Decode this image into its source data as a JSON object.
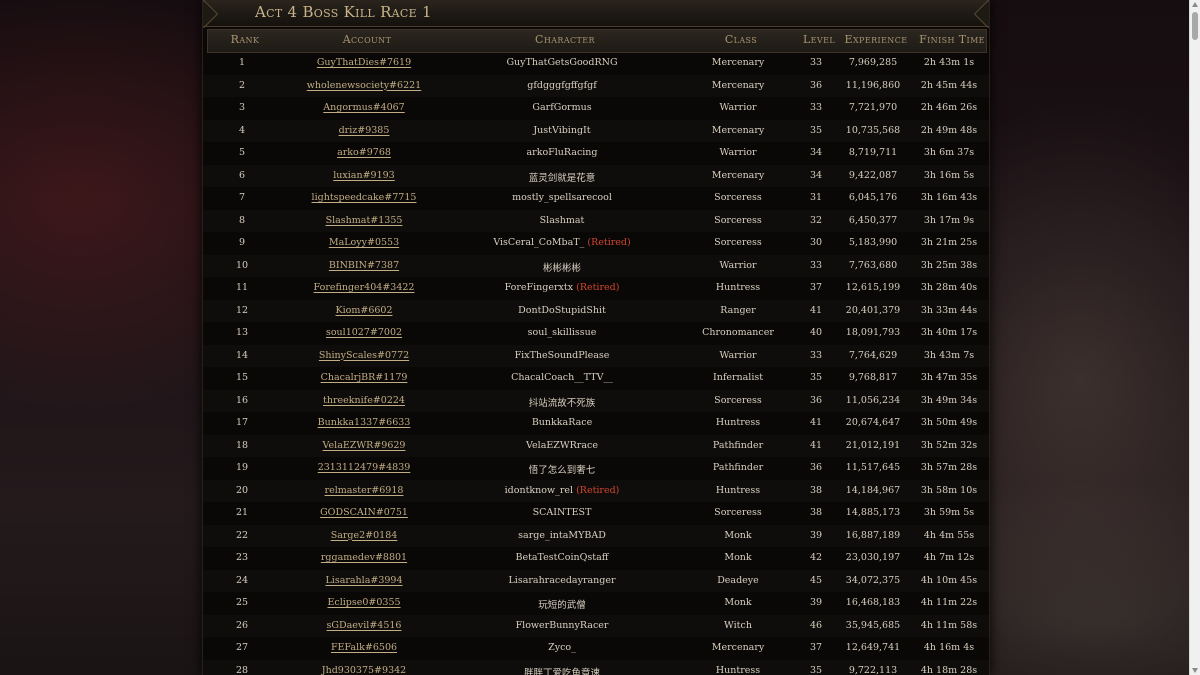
{
  "title": "Act 4 Boss Kill Race 1",
  "columns": {
    "rank": "Rank",
    "account": "Account",
    "character": "Character",
    "class": "Class",
    "level": "Level",
    "experience": "Experience",
    "finish_time": "Finish Time"
  },
  "retired_label": "(Retired)",
  "rows": [
    {
      "rank": "1",
      "account": "GuyThatDies#7619",
      "character": "GuyThatGetsGoodRNG",
      "retired": false,
      "class": "Mercenary",
      "level": "33",
      "experience": "7,969,285",
      "finish_time": "2h 43m 1s"
    },
    {
      "rank": "2",
      "account": "wholenewsociety#6221",
      "character": "gfdgggfgffgfgf",
      "retired": false,
      "class": "Mercenary",
      "level": "36",
      "experience": "11,196,860",
      "finish_time": "2h 45m 44s"
    },
    {
      "rank": "3",
      "account": "Angormus#4067",
      "character": "GarfGormus",
      "retired": false,
      "class": "Warrior",
      "level": "33",
      "experience": "7,721,970",
      "finish_time": "2h 46m 26s"
    },
    {
      "rank": "4",
      "account": "driz#9385",
      "character": "JustVibingIt",
      "retired": false,
      "class": "Mercenary",
      "level": "35",
      "experience": "10,735,568",
      "finish_time": "2h 49m 48s"
    },
    {
      "rank": "5",
      "account": "arko#9768",
      "character": "arkoFluRacing",
      "retired": false,
      "class": "Warrior",
      "level": "34",
      "experience": "8,719,711",
      "finish_time": "3h 6m 37s"
    },
    {
      "rank": "6",
      "account": "luxian#9193",
      "character": "蓝灵剑就是花意",
      "retired": false,
      "class": "Mercenary",
      "level": "34",
      "experience": "9,422,087",
      "finish_time": "3h 16m 5s"
    },
    {
      "rank": "7",
      "account": "lightspeedcake#7715",
      "character": "mostly_spellsarecool",
      "retired": false,
      "class": "Sorceress",
      "level": "31",
      "experience": "6,045,176",
      "finish_time": "3h 16m 43s"
    },
    {
      "rank": "8",
      "account": "Slashmat#1355",
      "character": "Slashmat",
      "retired": false,
      "class": "Sorceress",
      "level": "32",
      "experience": "6,450,377",
      "finish_time": "3h 17m 9s"
    },
    {
      "rank": "9",
      "account": "MaLoyy#0553",
      "character": "VisCeral_CoMbaT_",
      "retired": true,
      "class": "Sorceress",
      "level": "30",
      "experience": "5,183,990",
      "finish_time": "3h 21m 25s"
    },
    {
      "rank": "10",
      "account": "BINBIN#7387",
      "character": "彬彬彬彬",
      "retired": false,
      "class": "Warrior",
      "level": "33",
      "experience": "7,763,680",
      "finish_time": "3h 25m 38s"
    },
    {
      "rank": "11",
      "account": "Forefinger404#3422",
      "character": "ForeFingerxtx",
      "retired": true,
      "class": "Huntress",
      "level": "37",
      "experience": "12,615,199",
      "finish_time": "3h 28m 40s"
    },
    {
      "rank": "12",
      "account": "Kiom#6602",
      "character": "DontDoStupidShit",
      "retired": false,
      "class": "Ranger",
      "level": "41",
      "experience": "20,401,379",
      "finish_time": "3h 33m 44s"
    },
    {
      "rank": "13",
      "account": "soul1027#7002",
      "character": "soul_skillissue",
      "retired": false,
      "class": "Chronomancer",
      "level": "40",
      "experience": "18,091,793",
      "finish_time": "3h 40m 17s"
    },
    {
      "rank": "14",
      "account": "ShinyScales#0772",
      "character": "FixTheSoundPlease",
      "retired": false,
      "class": "Warrior",
      "level": "33",
      "experience": "7,764,629",
      "finish_time": "3h 43m 7s"
    },
    {
      "rank": "15",
      "account": "ChacalrjBR#1179",
      "character": "ChacalCoach__TTV__",
      "retired": false,
      "class": "Infernalist",
      "level": "35",
      "experience": "9,768,817",
      "finish_time": "3h 47m 35s"
    },
    {
      "rank": "16",
      "account": "threeknife#0224",
      "character": "抖站流故不死族",
      "retired": false,
      "class": "Sorceress",
      "level": "36",
      "experience": "11,056,234",
      "finish_time": "3h 49m 34s"
    },
    {
      "rank": "17",
      "account": "Bunkka1337#6633",
      "character": "BunkkaRace",
      "retired": false,
      "class": "Huntress",
      "level": "41",
      "experience": "20,674,647",
      "finish_time": "3h 50m 49s"
    },
    {
      "rank": "18",
      "account": "VelaEZWR#9629",
      "character": "VelaEZWRrace",
      "retired": false,
      "class": "Pathfinder",
      "level": "41",
      "experience": "21,012,191",
      "finish_time": "3h 52m 32s"
    },
    {
      "rank": "19",
      "account": "2313112479#4839",
      "character": "悟了怎么到奢七",
      "retired": false,
      "class": "Pathfinder",
      "level": "36",
      "experience": "11,517,645",
      "finish_time": "3h 57m 28s"
    },
    {
      "rank": "20",
      "account": "relmaster#6918",
      "character": "idontknow_rel",
      "retired": true,
      "class": "Huntress",
      "level": "38",
      "experience": "14,184,967",
      "finish_time": "3h 58m 10s"
    },
    {
      "rank": "21",
      "account": "GODSCAIN#0751",
      "character": "SCAINTEST",
      "retired": false,
      "class": "Sorceress",
      "level": "38",
      "experience": "14,885,173",
      "finish_time": "3h 59m 5s"
    },
    {
      "rank": "22",
      "account": "Sarge2#0184",
      "character": "sarge_intaMYBAD",
      "retired": false,
      "class": "Monk",
      "level": "39",
      "experience": "16,887,189",
      "finish_time": "4h 4m 55s"
    },
    {
      "rank": "23",
      "account": "rggamedev#8801",
      "character": "BetaTestCoinQstaff",
      "retired": false,
      "class": "Monk",
      "level": "42",
      "experience": "23,030,197",
      "finish_time": "4h 7m 12s"
    },
    {
      "rank": "24",
      "account": "Lisarahla#3994",
      "character": "Lisarahracedayranger",
      "retired": false,
      "class": "Deadeye",
      "level": "45",
      "experience": "34,072,375",
      "finish_time": "4h 10m 45s"
    },
    {
      "rank": "25",
      "account": "Eclipse0#0355",
      "character": "玩短的武僧",
      "retired": false,
      "class": "Monk",
      "level": "39",
      "experience": "16,468,183",
      "finish_time": "4h 11m 22s"
    },
    {
      "rank": "26",
      "account": "sGDaevil#4516",
      "character": "FlowerBunnyRacer",
      "retired": false,
      "class": "Witch",
      "level": "46",
      "experience": "35,945,685",
      "finish_time": "4h 11m 58s"
    },
    {
      "rank": "27",
      "account": "FEFalk#6506",
      "character": "Zyco_",
      "retired": false,
      "class": "Mercenary",
      "level": "37",
      "experience": "12,649,741",
      "finish_time": "4h 16m 4s"
    },
    {
      "rank": "28",
      "account": "Jhd930375#9342",
      "character": "胖胖丁爱吃鱼竟速",
      "retired": false,
      "class": "Huntress",
      "level": "35",
      "experience": "9,722,113",
      "finish_time": "4h 18m 28s"
    }
  ]
}
